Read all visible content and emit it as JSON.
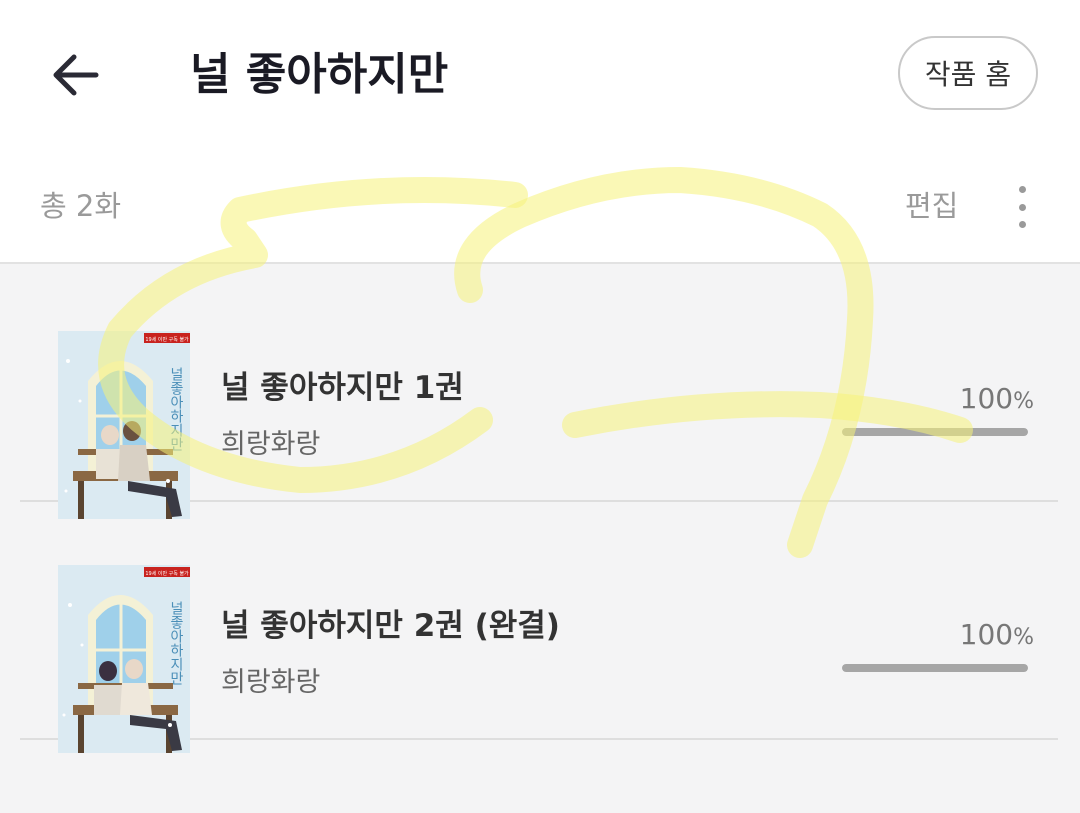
{
  "header": {
    "back_icon": "arrow-left-icon",
    "title": "널 좋아하지만",
    "home_button_label": "작품 홈"
  },
  "subbar": {
    "count_label": "총 2화",
    "edit_label": "편집",
    "more_icon": "vertical-ellipsis-icon"
  },
  "volumes": [
    {
      "title": "널 좋아하지만 1권",
      "author": "희랑화랑",
      "progress_value": "100",
      "progress_unit": "%",
      "progress_fraction": 1.0
    },
    {
      "title": "널 좋아하지만 2권 (완결)",
      "author": "희랑화랑",
      "progress_value": "100",
      "progress_unit": "%",
      "progress_fraction": 1.0
    }
  ],
  "cover": {
    "badge": "19세 이만 구독 불가",
    "vertical_title": "널좋아하지만"
  },
  "colors": {
    "accent_highlight": "#f6f27a",
    "progress_fill": "#a6a6a6"
  }
}
